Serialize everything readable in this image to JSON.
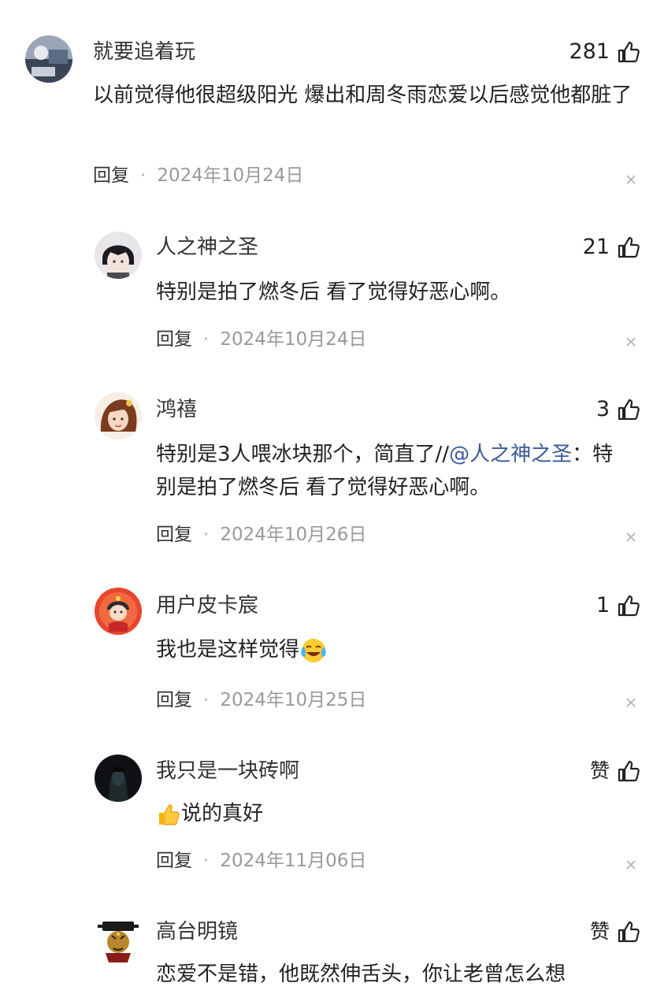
{
  "comments": [
    {
      "user": "就要追着玩",
      "likes": "281",
      "text": "以前觉得他很超级阳光 爆出和周冬雨恋爱以后感觉他都脏了",
      "reply_label": "回复",
      "date": "2024年10月24日",
      "avatar_icon": "avatar-photo-icon"
    },
    {
      "user": "人之神之圣",
      "likes": "21",
      "text": "特别是拍了燃冬后 看了觉得好恶心啊。",
      "reply_label": "回复",
      "date": "2024年10月24日",
      "avatar_icon": "avatar-anime-boy-icon"
    },
    {
      "user": "鸿禧",
      "likes": "3",
      "text_before": "特别是3人喂冰块那个，简直了//",
      "mention": "@人之神之圣",
      "text_after": "：特别是拍了燃冬后 看了觉得好恶心啊。",
      "reply_label": "回复",
      "date": "2024年10月26日",
      "avatar_icon": "avatar-anime-girl-icon"
    },
    {
      "user": "用户皮卡宸",
      "likes": "1",
      "text": "我也是这样觉得",
      "text_emoji": "laughing-crying-emoji-icon",
      "reply_label": "回复",
      "date": "2024年10月25日",
      "avatar_icon": "avatar-cartoon-icon"
    },
    {
      "user": "我只是一块砖啊",
      "likes": "赞",
      "text_emoji": "thumbs-up-emoji-icon",
      "text": "说的真好",
      "reply_label": "回复",
      "date": "2024年11月06日",
      "avatar_icon": "avatar-dark-icon"
    },
    {
      "user": "高台明镜",
      "likes": "赞",
      "text": "恋爱不是错，他既然伸舌头，你让老曾怎么想",
      "avatar_icon": "avatar-judge-icon"
    }
  ],
  "colors": {
    "mention": "#3b5998",
    "meta": "#999999",
    "text": "#222222"
  }
}
